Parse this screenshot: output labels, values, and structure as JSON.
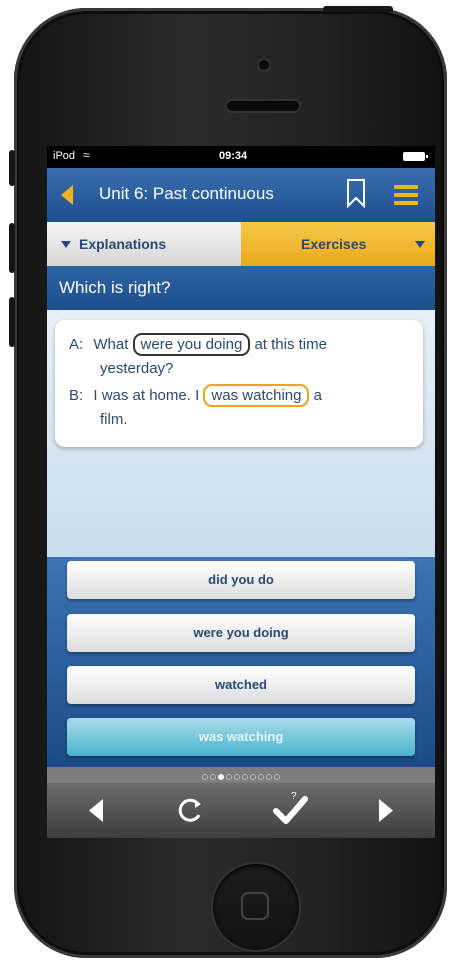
{
  "status_bar": {
    "carrier": "iPod",
    "time": "09:34"
  },
  "nav": {
    "title": "Unit 6: Past continuous"
  },
  "tabs": [
    {
      "label": "Explanations"
    },
    {
      "label": "Exercises"
    }
  ],
  "question": {
    "text": "Which is right?"
  },
  "dialogue": {
    "a_speaker": "A:",
    "a_pre": "What",
    "a_blank": "were you doing",
    "a_post": "at this time",
    "a_cont": "yesterday?",
    "b_speaker": "B:",
    "b_pre": "I was at home.  I",
    "b_blank": "was watching",
    "b_post": "a",
    "b_cont": "film."
  },
  "answers": [
    {
      "label": "did you do",
      "selected": false
    },
    {
      "label": "were you doing",
      "selected": false
    },
    {
      "label": "watched",
      "selected": false
    },
    {
      "label": "was watching",
      "selected": true
    }
  ],
  "pager": {
    "total": 10,
    "current": 3
  },
  "colors": {
    "accent": "#f2b31c",
    "nav_blue": "#1e4f8e",
    "selected_answer": "#49b3cb"
  },
  "icons": [
    "back-arrow-icon",
    "bookmark-icon",
    "menu-icon",
    "previous-icon",
    "refresh-icon",
    "check-answer-icon",
    "next-icon"
  ]
}
